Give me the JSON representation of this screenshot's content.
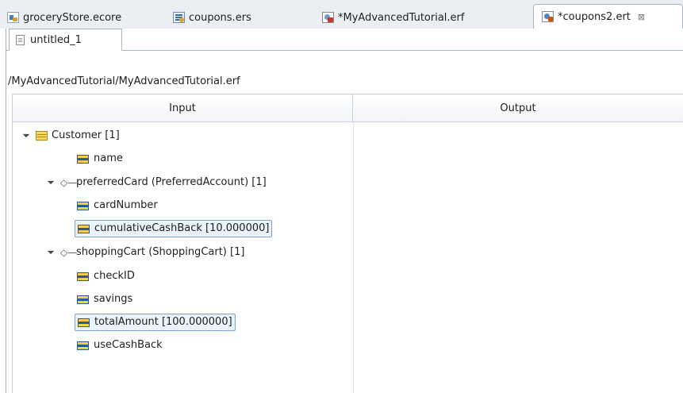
{
  "tabs": [
    {
      "label": "groceryStore.ecore",
      "icon": "ecore-file-icon",
      "active": false
    },
    {
      "label": "coupons.ers",
      "icon": "ers-file-icon",
      "active": false
    },
    {
      "label": "*MyAdvancedTutorial.erf",
      "icon": "erf-file-icon",
      "active": false
    },
    {
      "label": "*coupons2.ert",
      "icon": "ert-file-icon",
      "active": true
    }
  ],
  "close_glyph": "⊠",
  "subtab": {
    "label": "untitled_1",
    "icon": "document-icon"
  },
  "path": "/MyAdvancedTutorial/MyAdvancedTutorial.erf",
  "table": {
    "headers": {
      "input": "Input",
      "output": "Output"
    }
  },
  "tree": [
    {
      "label": "Customer [1]",
      "kind": "class",
      "expanded": true
    },
    {
      "label": "name",
      "kind": "attribute"
    },
    {
      "label": "preferredCard (PreferredAccount) [1]",
      "kind": "reference",
      "expanded": true
    },
    {
      "label": "cardNumber",
      "kind": "attribute"
    },
    {
      "label": "cumulativeCashBack [10.000000]",
      "kind": "attribute",
      "selected": true
    },
    {
      "label": "shoppingCart (ShoppingCart) [1]",
      "kind": "reference",
      "expanded": true
    },
    {
      "label": "checkID",
      "kind": "attribute"
    },
    {
      "label": "savings",
      "kind": "attribute"
    },
    {
      "label": "totalAmount [100.000000]",
      "kind": "attribute",
      "selected": true
    },
    {
      "label": "useCashBack",
      "kind": "attribute"
    }
  ],
  "glyphs": {
    "expanded_twisty": "◢",
    "reference": "◇—"
  },
  "colors": {
    "tab_bar": "#ebeef3",
    "border": "#a9b4c2",
    "selection": "#eaf2fc",
    "selection_border": "#7da2ce"
  }
}
